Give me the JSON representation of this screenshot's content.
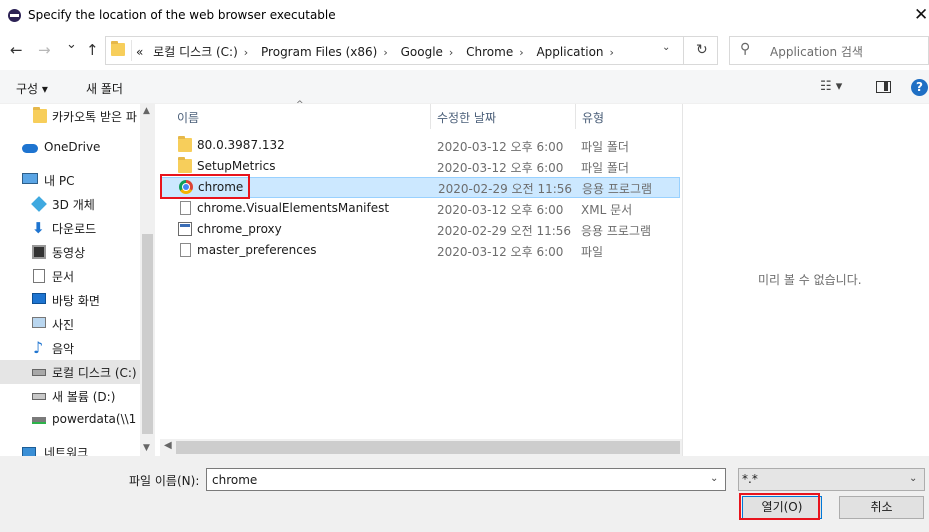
{
  "window": {
    "title": "Specify the location of the web browser executable",
    "close_glyph": "✕"
  },
  "nav": {
    "back": "←",
    "forward": "→",
    "recent": "⌄",
    "up": "↑",
    "breadcrumbs": [
      "«",
      "로컬 디스크 (C:)",
      "Program Files (x86)",
      "Google",
      "Chrome",
      "Application"
    ],
    "refresh": "↻",
    "search_placeholder": "Application 검색"
  },
  "toolbar": {
    "organize": "구성 ▾",
    "new_folder": "새 폴더",
    "view": "☷ ▾",
    "help": "?"
  },
  "sidebar": {
    "items": [
      {
        "label": "카카오톡 받은 파",
        "icon": "folder-icon"
      },
      {
        "label": "OneDrive",
        "icon": "cloud-icon"
      },
      {
        "label": "내 PC",
        "icon": "pc-icon"
      },
      {
        "label": "3D 개체",
        "icon": "cube-icon"
      },
      {
        "label": "다운로드",
        "icon": "download-icon"
      },
      {
        "label": "동영상",
        "icon": "video-icon"
      },
      {
        "label": "문서",
        "icon": "document-icon"
      },
      {
        "label": "바탕 화면",
        "icon": "desktop-icon"
      },
      {
        "label": "사진",
        "icon": "picture-icon"
      },
      {
        "label": "음악",
        "icon": "music-icon"
      },
      {
        "label": "로컬 디스크 (C:)",
        "icon": "drive-icon"
      },
      {
        "label": "새 볼륨 (D:)",
        "icon": "drive-icon"
      },
      {
        "label": "powerdata(\\\\1",
        "icon": "network-drive-icon"
      },
      {
        "label": "네트워크",
        "icon": "network-icon"
      }
    ]
  },
  "columns": {
    "name": "이름",
    "modified": "수정한 날짜",
    "type": "유형"
  },
  "files": [
    {
      "name": "80.0.3987.132",
      "modified": "2020-03-12 오후 6:00",
      "type": "파일 폴더",
      "icon": "folder-icon"
    },
    {
      "name": "SetupMetrics",
      "modified": "2020-03-12 오후 6:00",
      "type": "파일 폴더",
      "icon": "folder-icon"
    },
    {
      "name": "chrome",
      "modified": "2020-02-29 오전 11:56",
      "type": "응용 프로그램",
      "icon": "chrome-icon"
    },
    {
      "name": "chrome.VisualElementsManifest",
      "modified": "2020-03-12 오후 6:00",
      "type": "XML 문서",
      "icon": "file-icon"
    },
    {
      "name": "chrome_proxy",
      "modified": "2020-02-29 오전 11:56",
      "type": "응용 프로그램",
      "icon": "app-icon"
    },
    {
      "name": "master_preferences",
      "modified": "2020-03-12 오후 6:00",
      "type": "파일",
      "icon": "file-icon"
    }
  ],
  "preview": {
    "message": "미리 볼 수 없습니다."
  },
  "bottom": {
    "filename_label": "파일 이름(N):",
    "filename_value": "chrome",
    "filter_value": "*.*",
    "open_label": "열기(O)",
    "cancel_label": "취소"
  },
  "colors": {
    "selection": "#cce8ff",
    "highlight_box": "#e8141d",
    "accent": "#0078d7"
  }
}
